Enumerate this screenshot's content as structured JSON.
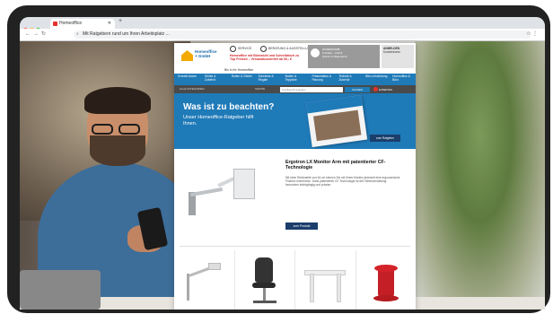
{
  "browser": {
    "tab_title": "Homeoffice",
    "url": "Mit Ratgebern rund um Ihren Arbeitsplatz ...",
    "colors": {
      "close": "#ff5f57",
      "min": "#febc2e",
      "max": "#28c840"
    }
  },
  "site": {
    "logo_line1": "Homeoffice",
    "logo_line2": "+ GmbH",
    "tagline": "Bis in Ihr Homeoffice",
    "header_buttons": [
      "SERVICE",
      "BERATUNG & AUSSTELLUNG"
    ],
    "promo": "Homeoffice mit Bürostuhl und Schreibtisch zu Top Preisen – Versandkostenfrei ab 50,- €",
    "cart": {
      "label": "WARENKORB",
      "line2": "0 Artikel – 0,00 €",
      "line3": "Nichts im Warenkorb"
    },
    "account": {
      "label": "ANMELDEN",
      "sub": "Kundenkonto"
    },
    "nav": [
      "Schreib-tische",
      "Stühle & Zubehör",
      "Rollen & Gleiter",
      "Schränke & Regale",
      "Boden & Teppiche",
      "Präsentation & Planung",
      "Technik & Zubehör",
      "Büro-einrichtung",
      "Homeoffice & Büro"
    ],
    "filter": {
      "select": "ALLE KATEGORIEN",
      "sort": "SORTIE",
      "search_placeholder": "Suchbegriff eingeben",
      "search_button": "SUCHEN",
      "expert": "EXPERTEN"
    },
    "banner": {
      "heading": "Was ist zu beachten?",
      "sub": "Unser Homeoffice-Ratgeber hilft Ihnen.",
      "button": "zum Ratgeber"
    },
    "product": {
      "title": "Ergotron LX Monitor Arm mit patentierter CF-Technologie",
      "description": "Mit einer Reichweite von 64 cm können Sie mit Ihrem Monitor jederzeit eine ergonomische Position einnehmen. Dank patentierter CF-Technologie ist die Höhenverstellung besonders leichtgängig und präzise.",
      "button": "zum Produkt"
    }
  },
  "colors": {
    "brand_blue": "#1f7ab8",
    "dark_blue": "#1b3e6b",
    "accent_red": "#e5312b",
    "logo_yellow": "#f2a900"
  }
}
